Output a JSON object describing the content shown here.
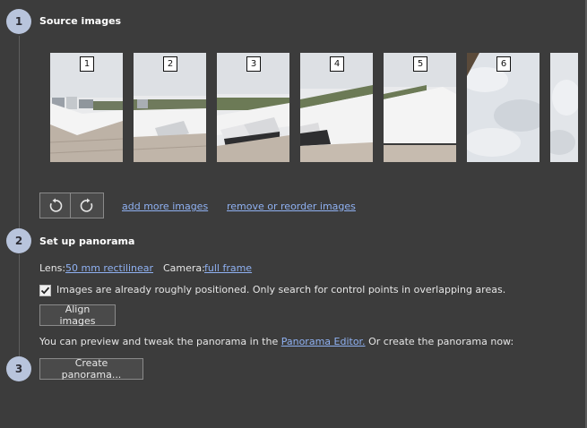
{
  "steps": [
    {
      "number": "1",
      "title": "Source images"
    },
    {
      "number": "2",
      "title": "Set up panorama"
    },
    {
      "number": "3",
      "title": ""
    }
  ],
  "thumbnails": [
    {
      "label": "1",
      "icon": "panorama-thumbnail"
    },
    {
      "label": "2",
      "icon": "panorama-thumbnail"
    },
    {
      "label": "3",
      "icon": "panorama-thumbnail"
    },
    {
      "label": "4",
      "icon": "panorama-thumbnail"
    },
    {
      "label": "5",
      "icon": "panorama-thumbnail"
    },
    {
      "label": "6",
      "icon": "panorama-thumbnail"
    }
  ],
  "source_images": {
    "rotate_left_icon": "rotate-ccw-icon",
    "rotate_right_icon": "rotate-cw-icon",
    "add_more_link": "add more images",
    "remove_reorder_link": "remove or reorder images"
  },
  "setup": {
    "lens_label": "Lens:",
    "lens_value": "50 mm rectilinear",
    "camera_label": "Camera:",
    "camera_value": "full frame",
    "checkbox_checked": true,
    "checkbox_label": "Images are already roughly positioned. Only search for control points in overlapping areas.",
    "align_button": "Align images",
    "preview_text_before": "You can preview and tweak the panorama in the",
    "preview_link": "Panorama Editor.",
    "preview_text_after": "Or create the panorama now:"
  },
  "create": {
    "create_button": "Create panorama..."
  },
  "colors": {
    "background": "#3c3c3c",
    "step_circle": "#b8c4dc",
    "link": "#8fb1f2",
    "button_border": "#8a8a8a"
  }
}
